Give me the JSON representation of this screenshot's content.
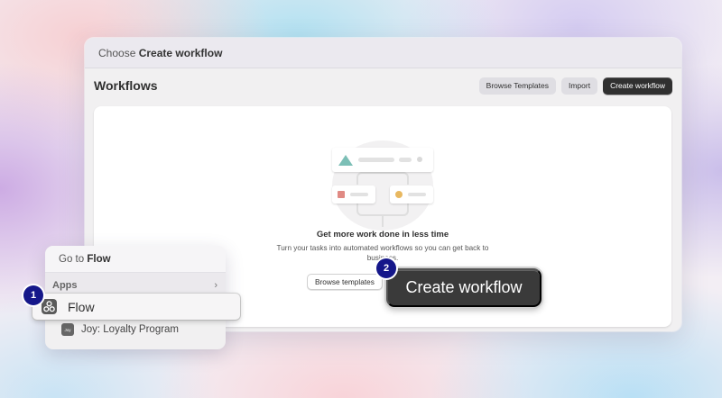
{
  "window": {
    "title_prefix": "Choose",
    "title_bold": "Create workflow"
  },
  "header": {
    "title": "Workflows",
    "browse_templates_label": "Browse Templates",
    "import_label": "Import",
    "create_workflow_label": "Create workflow"
  },
  "empty_state": {
    "title": "Get more work done in less time",
    "description": "Turn your tasks into automated workflows so you can get back to business.",
    "browse_templates_label": "Browse templates",
    "create_workflow_label": "Create workflow"
  },
  "steps": {
    "first": "1",
    "second": "2"
  },
  "palette": {
    "search_prefix": "Go to",
    "search_query": "Flow",
    "section_label": "Apps",
    "items": [
      {
        "label": "Flow",
        "icon": "flow-app-icon"
      },
      {
        "label": "Joy: Loyalty Program",
        "icon": "joy-app-icon",
        "icon_text": "Joy"
      }
    ]
  },
  "colors": {
    "primary_button": "#303030",
    "step_badge": "#15178a",
    "illus_teal": "#7cbfb6",
    "illus_red": "#e08a84",
    "illus_amber": "#e8b860"
  }
}
